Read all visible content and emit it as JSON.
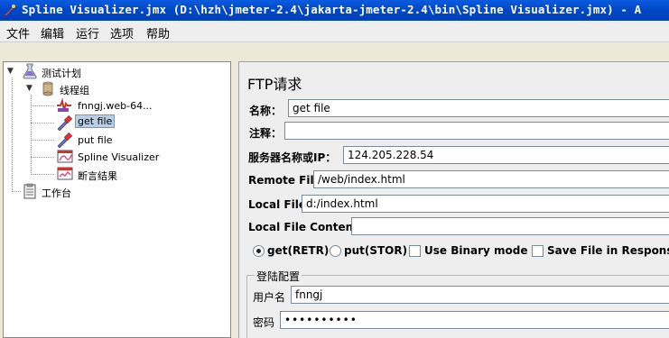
{
  "window": {
    "title": "Spline Visualizer.jmx (D:\\hzh\\jmeter-2.4\\jakarta-jmeter-2.4\\bin\\Spline Visualizer.jmx) - A"
  },
  "menu": [
    "文件",
    "编辑",
    "运行",
    "选项",
    "帮助"
  ],
  "tree": {
    "test_plan": "测试计划",
    "thread_group": "线程组",
    "sampler_http": "fnngj.web-64...",
    "sampler_get": "get file",
    "sampler_put": "put file",
    "listener_spline": "Spline Visualizer",
    "listener_assert": "断言结果",
    "workbench": "工作台"
  },
  "form": {
    "title": "FTP请求",
    "name_label": "名称：",
    "name_value": "get file",
    "comment_label": "注释：",
    "comment_value": "",
    "server_label": "服务器名称或IP：",
    "server_value": "124.205.228.54",
    "remote_label": "Remote File:",
    "remote_value": "/web/index.html",
    "local_label": "Local File:",
    "local_value": "d:/index.html",
    "contents_label": "Local File Contents:",
    "contents_value": "",
    "get_label": "get(RETR)",
    "put_label": "put(STOR)",
    "binary_label": "Use Binary mode ?",
    "save_label": "Save File in Response ?",
    "get_selected": true,
    "binary_checked": false,
    "save_checked": false
  },
  "login": {
    "legend": "登陆配置",
    "user_label": "用户名",
    "user_value": "fnngj",
    "password_label": "密码",
    "password_value": "••••••••••"
  }
}
